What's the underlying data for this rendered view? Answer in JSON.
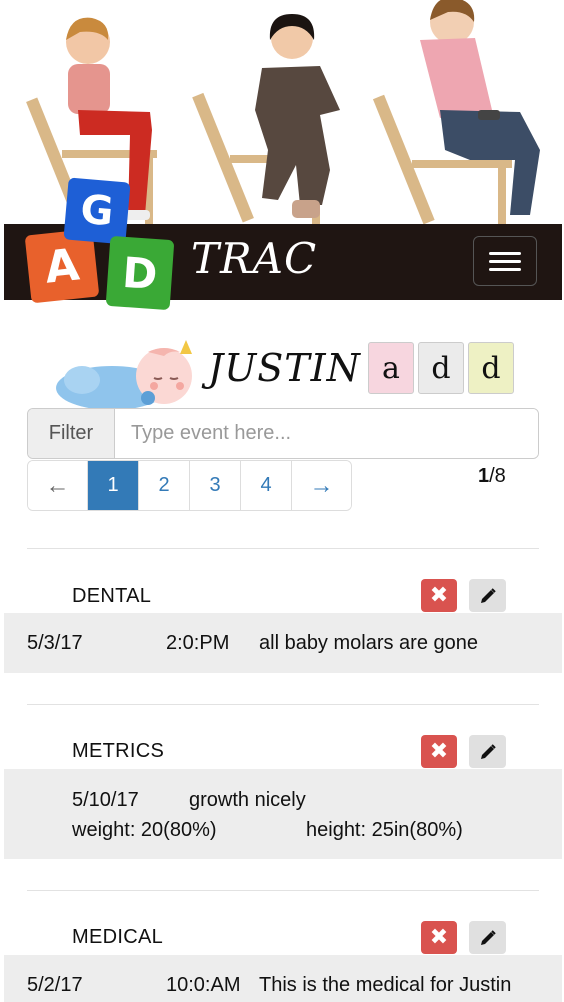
{
  "brand": {
    "blocks": [
      "A",
      "G",
      "D"
    ],
    "name": "TRAC"
  },
  "child": {
    "name": "JUSTIN"
  },
  "add_blocks": [
    "a",
    "d",
    "d"
  ],
  "filter": {
    "label": "Filter",
    "placeholder": "Type event here..."
  },
  "pagination": {
    "prev": "←",
    "pages": [
      "1",
      "2",
      "3",
      "4"
    ],
    "next": "→",
    "active_page": "1"
  },
  "page_count": {
    "current": "1",
    "total": "/8"
  },
  "events": [
    {
      "category": "DENTAL",
      "date": "5/3/17",
      "time": "2:0:PM",
      "note": "all baby molars are gone"
    },
    {
      "category": "METRICS",
      "date": "5/10/17",
      "note": "growth nicely",
      "weight": "weight: 20(80%)",
      "height": "height: 25in(80%)"
    },
    {
      "category": "MEDICAL",
      "date": "5/2/17",
      "time": "10:0:AM",
      "note": "This is the medical for Justin"
    }
  ],
  "colors": {
    "navbar": "#1f1512",
    "active_page": "#337ab7",
    "delete": "#d9534f",
    "detail_bg": "#ededed"
  }
}
